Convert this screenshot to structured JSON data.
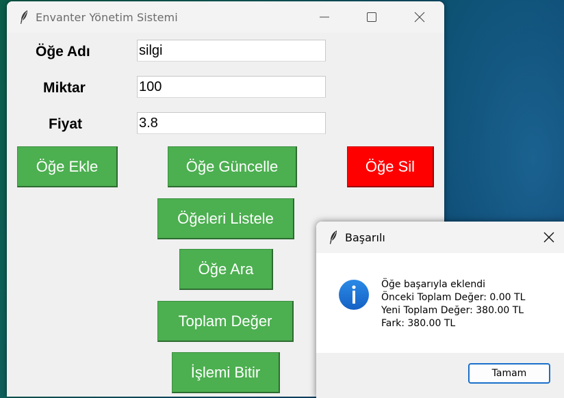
{
  "main_window": {
    "title": "Envanter Yönetim Sistemi",
    "form": {
      "name_label": "Öğe Adı",
      "name_value": "silgi",
      "quantity_label": "Miktar",
      "quantity_value": "100",
      "price_label": "Fiyat",
      "price_value": "3.8"
    },
    "buttons": {
      "add": "Öğe Ekle",
      "update": "Öğe Güncelle",
      "delete": "Öğe Sil",
      "list": "Öğeleri Listele",
      "search": "Öğe Ara",
      "total": "Toplam Değer",
      "finish": "İşlemi Bitir"
    }
  },
  "dialog": {
    "title": "Başarılı",
    "message_lines": [
      "Öğe başarıyla eklendi",
      "Önceki Toplam Değer: 0.00 TL",
      "Yeni Toplam Değer: 380.00 TL",
      "Fark: 380.00 TL"
    ],
    "ok_label": "Tamam",
    "icon": "info-icon"
  },
  "colors": {
    "button_green": "#4caf50",
    "button_red": "#ff0000",
    "info_blue": "#1a73d9"
  },
  "icons": {
    "app": "feather-icon",
    "minimize": "minimize-icon",
    "maximize": "maximize-icon",
    "close": "close-icon"
  }
}
